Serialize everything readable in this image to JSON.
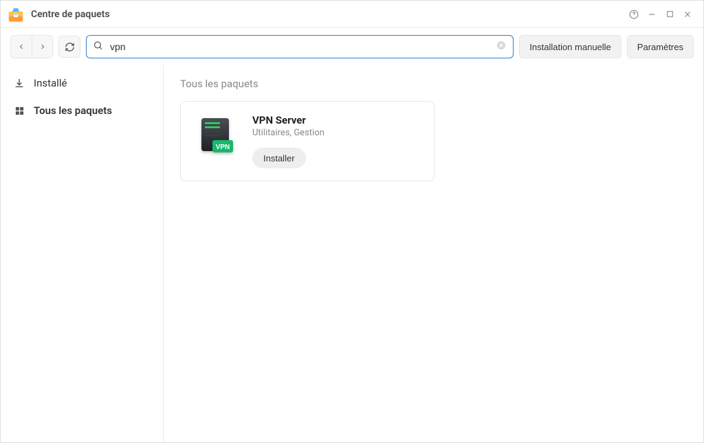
{
  "window": {
    "title": "Centre de paquets"
  },
  "toolbar": {
    "search_value": "vpn",
    "search_placeholder": "",
    "manual_install_label": "Installation manuelle",
    "settings_label": "Paramètres"
  },
  "sidebar": {
    "items": [
      {
        "id": "installed",
        "label": "Installé",
        "icon": "download-icon"
      },
      {
        "id": "all",
        "label": "Tous les paquets",
        "icon": "grid-icon"
      }
    ],
    "active": "all"
  },
  "content": {
    "section_title": "Tous les paquets",
    "packages": [
      {
        "name": "VPN Server",
        "category": "Utilitaires, Gestion",
        "install_label": "Installer",
        "icon": "vpn-server-icon"
      }
    ]
  }
}
